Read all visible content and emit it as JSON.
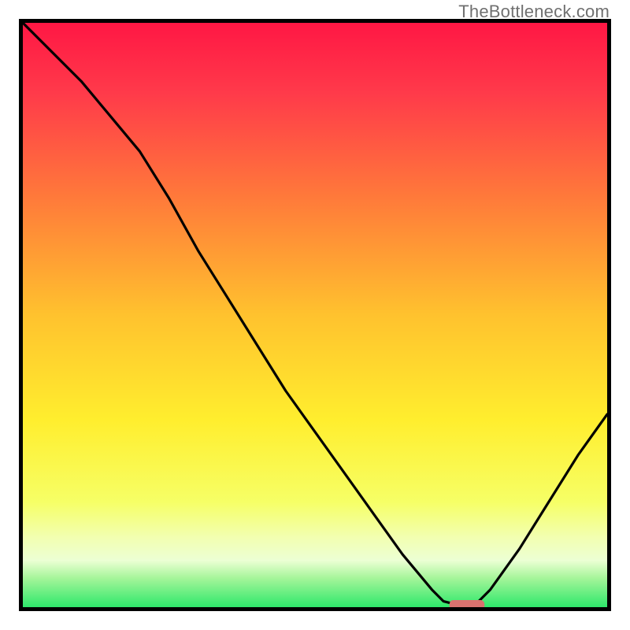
{
  "watermark": "TheBottleneck.com",
  "chart_data": {
    "type": "line",
    "title": "",
    "xlabel": "",
    "ylabel": "",
    "xlim": [
      0,
      100
    ],
    "ylim": [
      0,
      100
    ],
    "grid": false,
    "legend": false,
    "series": [
      {
        "name": "bottleneck-curve",
        "x": [
          0,
          5,
          10,
          15,
          20,
          25,
          30,
          35,
          40,
          45,
          50,
          55,
          60,
          65,
          70,
          72,
          74,
          76,
          78,
          80,
          85,
          90,
          95,
          100
        ],
        "y": [
          100,
          95,
          90,
          84,
          78,
          70,
          61,
          53,
          45,
          37,
          30,
          23,
          16,
          9,
          3,
          1,
          0.5,
          0.5,
          1,
          3,
          10,
          18,
          26,
          33
        ]
      }
    ],
    "marker": {
      "name": "optimal-range",
      "x_start": 73,
      "x_end": 79,
      "y": 0,
      "color": "#d9726f"
    },
    "background_gradient": {
      "stops": [
        {
          "pos": 0.0,
          "color": "#ff1744"
        },
        {
          "pos": 0.12,
          "color": "#ff3a4a"
        },
        {
          "pos": 0.3,
          "color": "#ff7a3a"
        },
        {
          "pos": 0.5,
          "color": "#ffc22e"
        },
        {
          "pos": 0.68,
          "color": "#ffee2e"
        },
        {
          "pos": 0.82,
          "color": "#f6ff66"
        },
        {
          "pos": 0.88,
          "color": "#f2ffb0"
        },
        {
          "pos": 0.92,
          "color": "#ecffd4"
        },
        {
          "pos": 0.95,
          "color": "#a6f59a"
        },
        {
          "pos": 1.0,
          "color": "#2ee86b"
        }
      ]
    }
  }
}
